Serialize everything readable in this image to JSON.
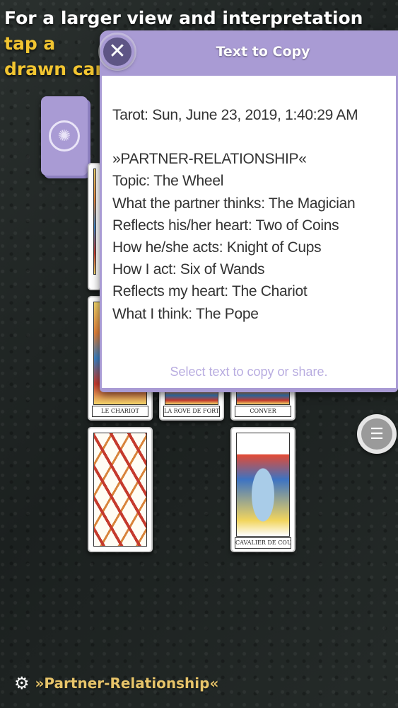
{
  "hint": {
    "text_before": "For a larger view and interpretation ",
    "highlight_line1": "tap a",
    "highlight_line2": "drawn card"
  },
  "cards": [
    {
      "title": "LE CHARIOT"
    },
    {
      "title": "LA ROVE DE FORTVNE"
    },
    {
      "title": "CONVER"
    },
    {
      "title": ""
    },
    {
      "title": "CAVALIER DE COUPE"
    }
  ],
  "dialog": {
    "title": "Text to Copy",
    "close_icon": "close-icon",
    "timestamp": "Tarot: Sun, June 23, 2019, 1:40:29 AM",
    "heading": "»PARTNER-RELATIONSHIP«",
    "lines": [
      "Topic: The Wheel",
      "What the partner thinks: The Magician",
      "Reflects his/her heart: Two of Coins",
      "How he/she acts: Knight of Cups",
      "How I act: Six of Wands",
      "Reflects my heart: The Chariot",
      "What I think: The Pope"
    ],
    "footer": "Select text to copy or share."
  },
  "bottom": {
    "settings_icon": "gear-icon",
    "spread_name": "»Partner-Relationship«"
  },
  "menu": {
    "icon": "list-icon"
  },
  "colors": {
    "accent": "#a99bd4",
    "highlight": "#f2c531",
    "spread_name": "#e7c46a",
    "background": "#1f2523"
  }
}
